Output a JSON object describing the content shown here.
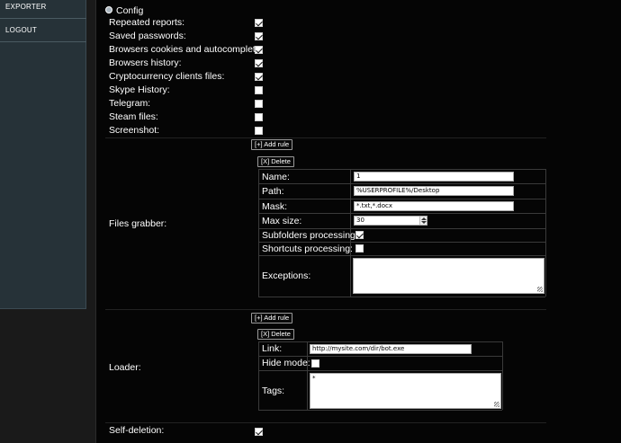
{
  "sidebar": {
    "items": [
      {
        "label": "EXPORTER"
      },
      {
        "label": "LOGOUT"
      }
    ]
  },
  "header": {
    "title": "Config",
    "icon": "gear-icon"
  },
  "options": [
    {
      "label": "Repeated reports:",
      "checked": true
    },
    {
      "label": "Saved passwords:",
      "checked": true
    },
    {
      "label": "Browsers cookies and autocomplete:",
      "checked": true
    },
    {
      "label": "Browsers history:",
      "checked": true
    },
    {
      "label": "Cryptocurrency clients files:",
      "checked": true
    },
    {
      "label": "Skype History:",
      "checked": false
    },
    {
      "label": "Telegram:",
      "checked": false
    },
    {
      "label": "Steam files:",
      "checked": false
    },
    {
      "label": "Screenshot:",
      "checked": false
    }
  ],
  "files_grabber": {
    "label": "Files grabber:",
    "add_rule": "[+] Add rule",
    "delete": "[X] Delete",
    "fields": {
      "name_label": "Name:",
      "name_value": "1",
      "path_label": "Path:",
      "path_value": "%USERPROFILE%/Desktop",
      "mask_label": "Mask:",
      "mask_value": "*.txt,*.docx",
      "maxsize_label": "Max size:",
      "maxsize_value": "30",
      "subfolders_label": "Subfolders processing:",
      "subfolders_checked": true,
      "shortcuts_label": "Shortcuts processing:",
      "shortcuts_checked": false,
      "exceptions_label": "Exceptions:",
      "exceptions_value": ""
    }
  },
  "loader": {
    "label": "Loader:",
    "add_rule": "[+] Add rule",
    "delete": "[X] Delete",
    "fields": {
      "link_label": "Link:",
      "link_value": "http://mysite.com/dir/bot.exe",
      "hide_label": "Hide mode:",
      "hide_checked": false,
      "tags_label": "Tags:",
      "tags_value": "*"
    }
  },
  "self_deletion": {
    "label": "Self-deletion:",
    "checked": true
  }
}
